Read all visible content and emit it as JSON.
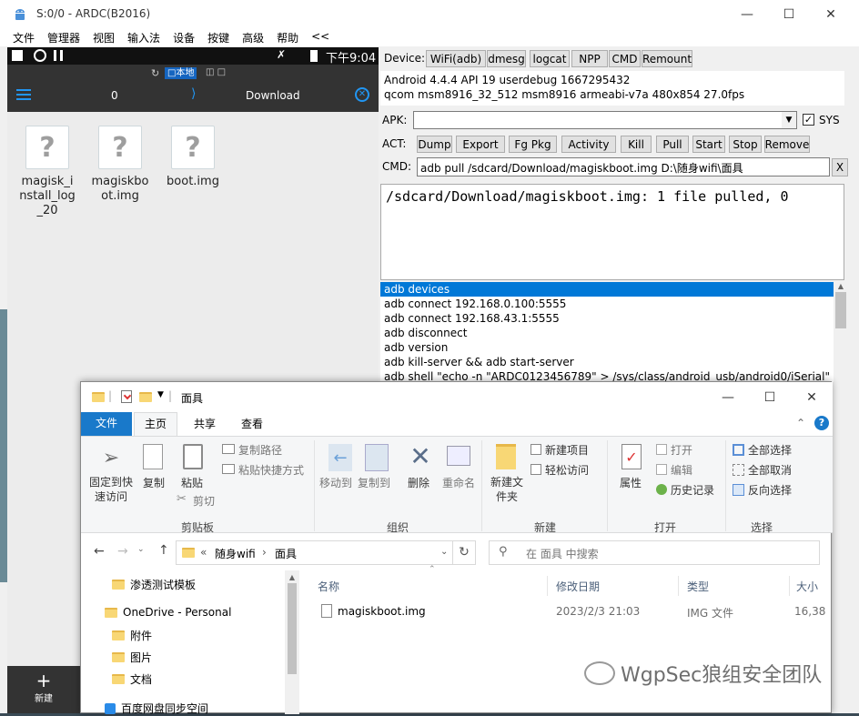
{
  "ardc": {
    "title": "S:0/0 - ARDC(B2016)",
    "menu": [
      "文件",
      "管理器",
      "视图",
      "输入法",
      "设备",
      "按键",
      "高级",
      "帮助",
      "<<"
    ],
    "phone": {
      "time": "下午9:04",
      "local_label": "本地",
      "nav_count": "0",
      "nav_folder": "Download",
      "files": [
        {
          "name": "magisk_install_log_20"
        },
        {
          "name": "magiskboot.img"
        },
        {
          "name": "boot.img"
        }
      ],
      "new_label": "新建"
    },
    "device_label": "Device:",
    "device_buttons": [
      "WiFi(adb)",
      "dmesg",
      "logcat",
      "NPP",
      "CMD",
      "Remount"
    ],
    "info_lines": [
      "Android 4.4.4 API 19 userdebug 1667295432",
      "qcom msm8916_32_512 msm8916 armeabi-v7a 480x854 27.0fps"
    ],
    "apk_label": "APK:",
    "apk_value": "",
    "sys_label": "SYS",
    "act_label": "ACT:",
    "act_buttons": [
      "Dump",
      "Export",
      "Fg Pkg",
      "Activity",
      "Kill",
      "Pull",
      "Start",
      "Stop",
      "Remove"
    ],
    "cmd_label": "CMD:",
    "cmd_value": "adb pull /sdcard/Download/magiskboot.img D:\\随身wifi\\面具",
    "cmd_clear": "X",
    "output": "/sdcard/Download/magiskboot.img: 1 file pulled, 0",
    "cmd_history": [
      "adb devices",
      "adb connect 192.168.0.100:5555",
      "adb connect 192.168.43.1:5555",
      "adb disconnect",
      "adb version",
      "adb kill-server && adb start-server",
      "adb shell \"echo -n \"ARDC0123456789\" > /sys/class/android_usb/android0/iSerial\""
    ]
  },
  "explorer": {
    "title": "面具",
    "tabs": [
      "文件",
      "主页",
      "共享",
      "查看"
    ],
    "ribbon": {
      "pin": "固定到快速访问",
      "copy": "复制",
      "paste": "粘贴",
      "copy_path": "复制路径",
      "paste_shortcut": "粘贴快捷方式",
      "cut": "剪切",
      "group_clipboard": "剪贴板",
      "move_to": "移动到",
      "copy_to": "复制到",
      "delete": "删除",
      "rename": "重命名",
      "group_organize": "组织",
      "new_folder": "新建文件夹",
      "new_item": "新建项目",
      "easy_access": "轻松访问",
      "group_new": "新建",
      "properties": "属性",
      "open": "打开",
      "edit": "编辑",
      "history": "历史记录",
      "group_open": "打开",
      "select_all": "全部选择",
      "select_none": "全部取消",
      "invert": "反向选择",
      "group_select": "选择"
    },
    "address": {
      "crumb_prefix": "«",
      "crumb1": "随身wifi",
      "crumb2": "面具"
    },
    "search_placeholder": "在 面具 中搜索",
    "nav_items": [
      "渗透测试模板",
      "OneDrive - Personal",
      "附件",
      "图片",
      "文档",
      "百度网盘同步空间"
    ],
    "columns": [
      "名称",
      "修改日期",
      "类型",
      "大小"
    ],
    "files": [
      {
        "name": "magiskboot.img",
        "date": "2023/2/3 21:03",
        "type": "IMG 文件",
        "size": "16,38"
      }
    ]
  },
  "watermark": "WgpSec狼组安全团队",
  "colors": {
    "selection": "#0078d7",
    "ribbon_file_tab": "#1979ca",
    "folder": "#f8d775"
  }
}
